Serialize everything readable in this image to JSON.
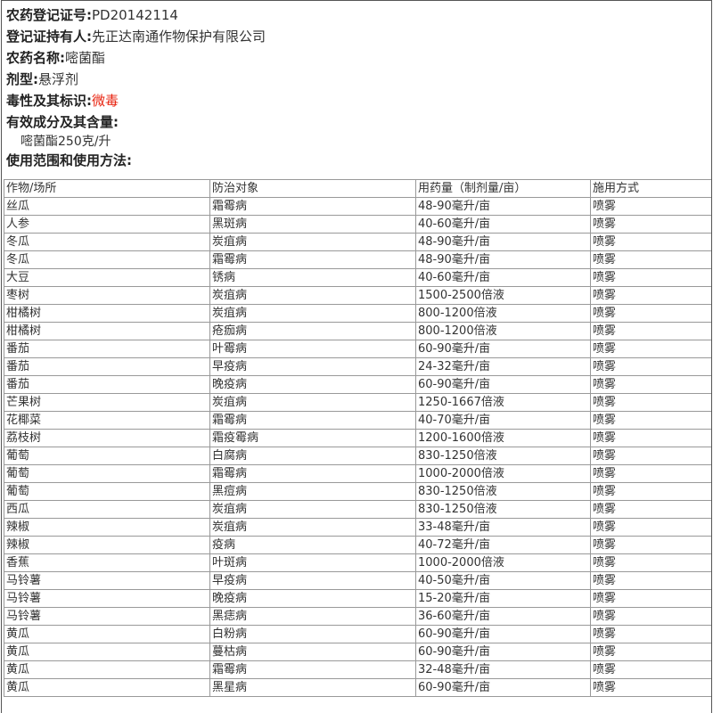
{
  "reg_no": {
    "label": "农药登记证号:",
    "value": "PD20142114"
  },
  "holder": {
    "label": "登记证持有人:",
    "value": "先正达南通作物保护有限公司"
  },
  "name": {
    "label": "农药名称:",
    "value": "嘧菌酯"
  },
  "formulation": {
    "label": "剂型:",
    "value": "悬浮剂"
  },
  "toxicity": {
    "label": "毒性及其标识:",
    "value": "微毒",
    "color": "#e8230f"
  },
  "ingredients": {
    "label": "有效成分及其含量:",
    "value": "嘧菌酯250克/升"
  },
  "usage": {
    "label": "使用范围和使用方法:",
    "headers": [
      "作物/场所",
      "防治对象",
      "用药量（制剂量/亩）",
      "施用方式"
    ],
    "rows": [
      [
        "丝瓜",
        "霜霉病",
        "48-90毫升/亩",
        "喷雾"
      ],
      [
        "人参",
        "黑斑病",
        "40-60毫升/亩",
        "喷雾"
      ],
      [
        "冬瓜",
        "炭疽病",
        "48-90毫升/亩",
        "喷雾"
      ],
      [
        "冬瓜",
        "霜霉病",
        "48-90毫升/亩",
        "喷雾"
      ],
      [
        "大豆",
        "锈病",
        "40-60毫升/亩",
        "喷雾"
      ],
      [
        "枣树",
        "炭疽病",
        "1500-2500倍液",
        "喷雾"
      ],
      [
        "柑橘树",
        "炭疽病",
        "800-1200倍液",
        "喷雾"
      ],
      [
        "柑橘树",
        "疮痂病",
        "800-1200倍液",
        "喷雾"
      ],
      [
        "番茄",
        "叶霉病",
        "60-90毫升/亩",
        "喷雾"
      ],
      [
        "番茄",
        "早疫病",
        "24-32毫升/亩",
        "喷雾"
      ],
      [
        "番茄",
        "晚疫病",
        "60-90毫升/亩",
        "喷雾"
      ],
      [
        "芒果树",
        "炭疽病",
        "1250-1667倍液",
        "喷雾"
      ],
      [
        "花椰菜",
        "霜霉病",
        "40-70毫升/亩",
        "喷雾"
      ],
      [
        "荔枝树",
        "霜疫霉病",
        "1200-1600倍液",
        "喷雾"
      ],
      [
        "葡萄",
        "白腐病",
        "830-1250倍液",
        "喷雾"
      ],
      [
        "葡萄",
        "霜霉病",
        "1000-2000倍液",
        "喷雾"
      ],
      [
        "葡萄",
        "黑痘病",
        "830-1250倍液",
        "喷雾"
      ],
      [
        "西瓜",
        "炭疽病",
        "830-1250倍液",
        "喷雾"
      ],
      [
        "辣椒",
        "炭疽病",
        "33-48毫升/亩",
        "喷雾"
      ],
      [
        "辣椒",
        "疫病",
        "40-72毫升/亩",
        "喷雾"
      ],
      [
        "香蕉",
        "叶斑病",
        "1000-2000倍液",
        "喷雾"
      ],
      [
        "马铃薯",
        "早疫病",
        "40-50毫升/亩",
        "喷雾"
      ],
      [
        "马铃薯",
        "晚疫病",
        "15-20毫升/亩",
        "喷雾"
      ],
      [
        "马铃薯",
        "黑痣病",
        "36-60毫升/亩",
        "喷雾"
      ],
      [
        "黄瓜",
        "白粉病",
        "60-90毫升/亩",
        "喷雾"
      ],
      [
        "黄瓜",
        "蔓枯病",
        "60-90毫升/亩",
        "喷雾"
      ],
      [
        "黄瓜",
        "霜霉病",
        "32-48毫升/亩",
        "喷雾"
      ],
      [
        "黄瓜",
        "黑星病",
        "60-90毫升/亩",
        "喷雾"
      ]
    ]
  }
}
